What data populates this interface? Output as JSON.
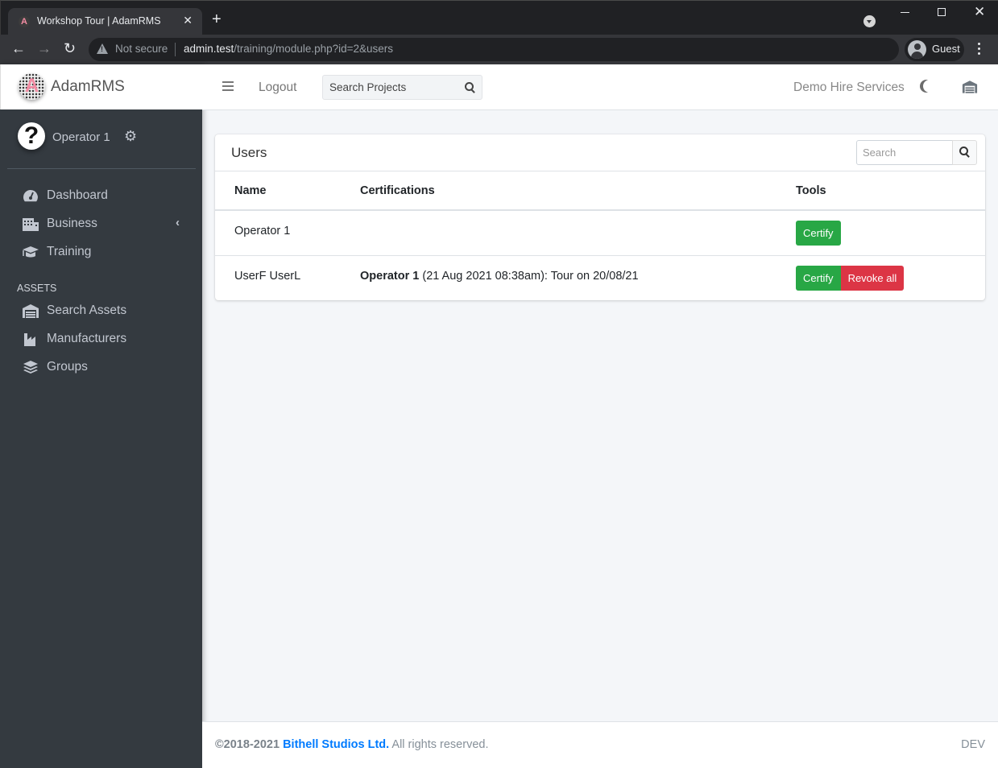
{
  "browser": {
    "tab_title": "Workshop Tour | AdamRMS",
    "favicon_letter": "A",
    "security_label": "Not secure",
    "url_host": "admin.test",
    "url_path": "/training/module.php?id=2&users",
    "profile_label": "Guest"
  },
  "brand": {
    "name": "AdamRMS",
    "logo_letter": "A"
  },
  "user": {
    "name": "Operator 1",
    "avatar_glyph": "?"
  },
  "sidebar": {
    "items": [
      {
        "label": "Dashboard",
        "icon": "tachometer-icon"
      },
      {
        "label": "Business",
        "icon": "building-icon",
        "has_submenu": true
      },
      {
        "label": "Training",
        "icon": "graduation-cap-icon"
      }
    ],
    "section_header": "ASSETS",
    "asset_items": [
      {
        "label": "Search Assets",
        "icon": "warehouse-icon"
      },
      {
        "label": "Manufacturers",
        "icon": "industry-icon"
      },
      {
        "label": "Groups",
        "icon": "layer-group-icon"
      }
    ]
  },
  "navbar": {
    "logout_label": "Logout",
    "search_placeholder": "Search Projects",
    "org_name": "Demo Hire Services"
  },
  "card": {
    "title": "Users",
    "search_placeholder": "Search",
    "columns": [
      "Name",
      "Certifications",
      "Tools"
    ],
    "rows": [
      {
        "name": "Operator 1",
        "cert_bold": "",
        "cert_text": "",
        "buttons": [
          "Certify"
        ]
      },
      {
        "name": "UserF UserL",
        "cert_bold": "Operator 1",
        "cert_text": " (21 Aug 2021 08:38am): Tour on 20/08/21",
        "buttons": [
          "Certify",
          "Revoke all"
        ]
      }
    ]
  },
  "footer": {
    "copyright": "©2018-2021",
    "company": "Bithell Studios Ltd.",
    "rights": " All rights reserved.",
    "env": "DEV"
  },
  "colors": {
    "success": "#28a745",
    "danger": "#dc3545",
    "link": "#007bff",
    "sidebar_bg": "#343a40"
  }
}
